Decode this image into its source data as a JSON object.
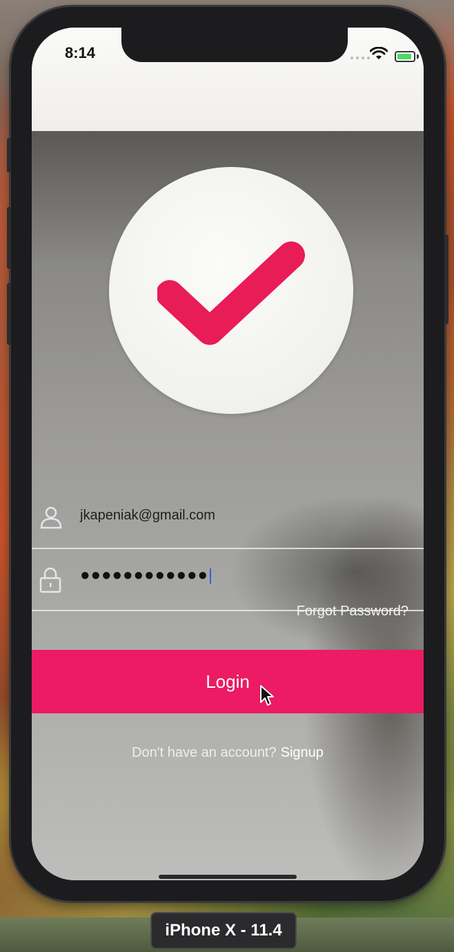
{
  "status_bar": {
    "time": "8:14",
    "icons": [
      "cellular-signal-icon",
      "wifi-icon",
      "battery-charging-icon"
    ]
  },
  "logo": {
    "icon": "checkmark-icon",
    "accent_color": "#ec1b63"
  },
  "form": {
    "email_icon": "user-icon",
    "email_value": "jkapeniak@gmail.com",
    "password_icon": "lock-icon",
    "password_value": "●●●●●●●●●●●●",
    "forgot_label": "Forgot Password?",
    "login_label": "Login",
    "signup_prompt": "Don't have an account?",
    "signup_link": "Signup"
  },
  "simulator": {
    "device_label": "iPhone X - 11.4"
  },
  "colors": {
    "button": "#ec1b63",
    "field_underline": "#ebebeb"
  }
}
